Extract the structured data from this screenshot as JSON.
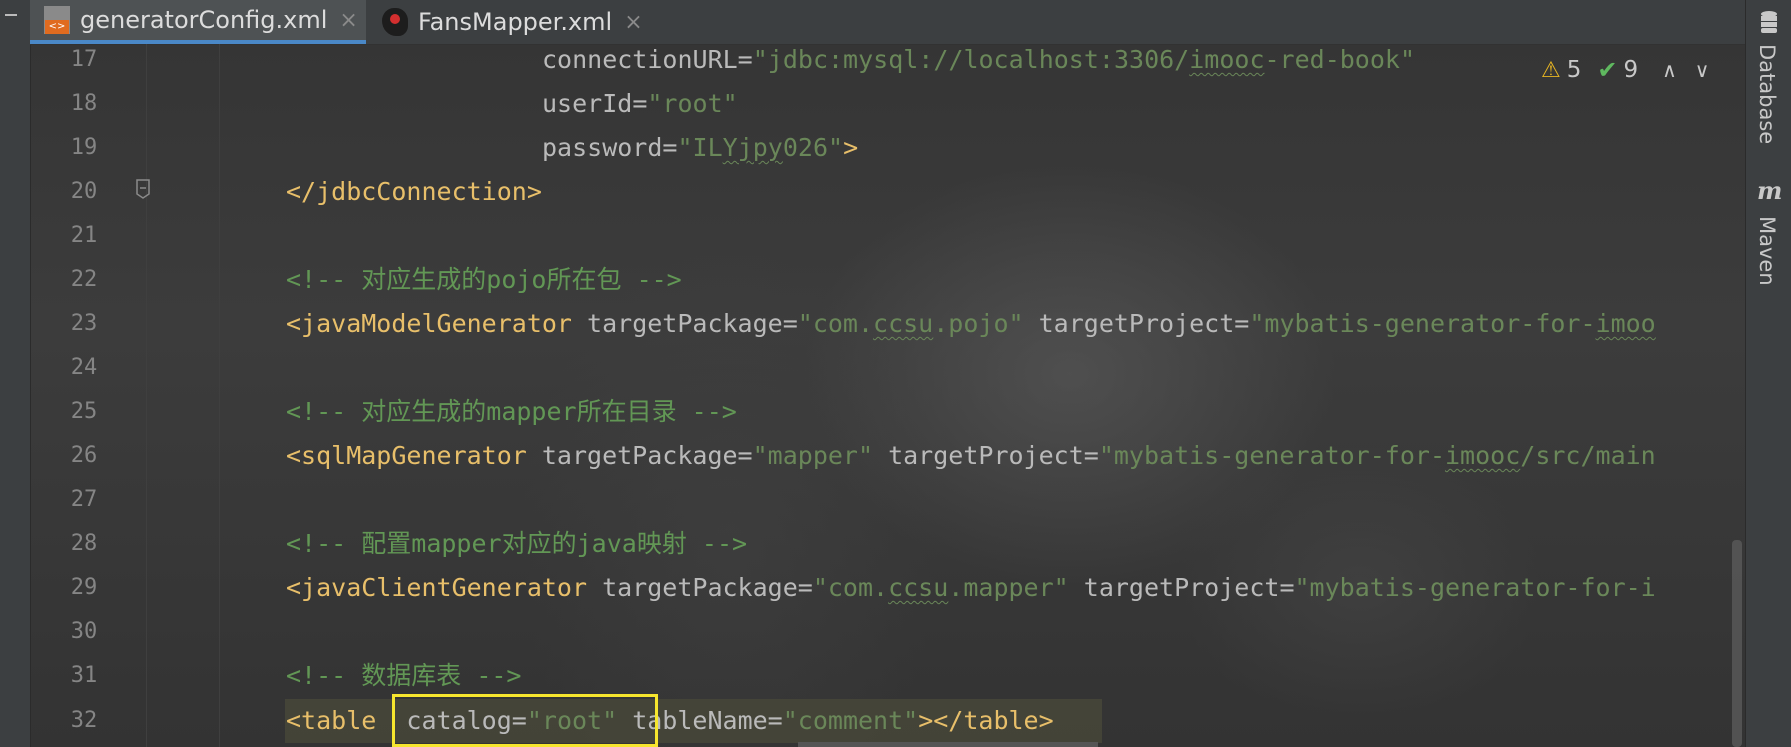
{
  "tabs": [
    {
      "label": "generatorConfig.xml",
      "close": "×",
      "active": true,
      "icon": "xml-file-icon"
    },
    {
      "label": "FansMapper.xml",
      "close": "×",
      "active": false,
      "icon": "mybatis-bird-icon"
    }
  ],
  "right_tools": {
    "database": "Database",
    "maven": "Maven",
    "maven_glyph": "m"
  },
  "inspections": {
    "warnings": "5",
    "weak_warnings": "9",
    "warn_glyph": "⚠",
    "ok_glyph": "✔",
    "prev_glyph": "∧",
    "next_glyph": "∨"
  },
  "line_numbers": [
    "17",
    "18",
    "19",
    "20",
    "21",
    "22",
    "23",
    "24",
    "25",
    "26",
    "27",
    "28",
    "29",
    "30",
    "31",
    "32"
  ],
  "code": {
    "l17": {
      "attr": "connectionURL",
      "eq": "=",
      "val_a": "\"jdbc:mysql://localhost:3306/",
      "val_b": "imooc",
      "val_c": "-red-book\""
    },
    "l18": {
      "attr": "userId",
      "eq": "=",
      "val": "\"root\""
    },
    "l19": {
      "attr": "password",
      "eq": "=",
      "val_a": "\"IL",
      "val_b": "Yjpy",
      "val_c": "026\"",
      "close": ">"
    },
    "l20": {
      "tag": "</jdbcConnection>"
    },
    "l22": {
      "open": "<!-- ",
      "cjk1": "对应生成的",
      "latin": "pojo",
      "cjk2": "所在包",
      "close": " -->"
    },
    "l23": {
      "tag": "<javaModelGenerator",
      "attr1": " targetPackage",
      "eq": "=",
      "val1_a": "\"com.",
      "val1_b": "ccsu",
      "val1_c": ".pojo\"",
      "attr2": " targetProject",
      "val2_a": "\"mybatis-generator-for-",
      "val2_b": "imoo"
    },
    "l25": {
      "open": "<!-- ",
      "cjk1": "对应生成的",
      "latin": "mapper",
      "cjk2": "所在目录",
      "close": " -->"
    },
    "l26": {
      "tag": "<sqlMapGenerator",
      "attr1": " targetPackage",
      "eq": "=",
      "val1": "\"mapper\"",
      "attr2": " targetProject",
      "val2_a": "\"mybatis-generator-for-",
      "val2_b": "imooc",
      "val2_c": "/src/main"
    },
    "l28": {
      "open": "<!-- ",
      "cjk1": "配置",
      "latin1": "mapper",
      "cjk2": "对应的",
      "latin2": "java",
      "cjk3": "映射",
      "close": " -->"
    },
    "l29": {
      "tag": "<javaClientGenerator",
      "attr1": " targetPackage",
      "eq": "=",
      "val1_a": "\"com.",
      "val1_b": "ccsu",
      "val1_c": ".mapper\"",
      "attr2": " targetProject",
      "val2": "\"mybatis-generator-for-i"
    },
    "l31": {
      "open": "<!-- ",
      "cjk": "数据库表",
      "close": " -->"
    },
    "l32": {
      "tag_open": "<table",
      "attr1": "  catalog",
      "eq": "=",
      "val1": "\"root\"",
      "attr2": " tableName",
      "val2": "\"comment\"",
      "tag_close": "></table>"
    }
  }
}
